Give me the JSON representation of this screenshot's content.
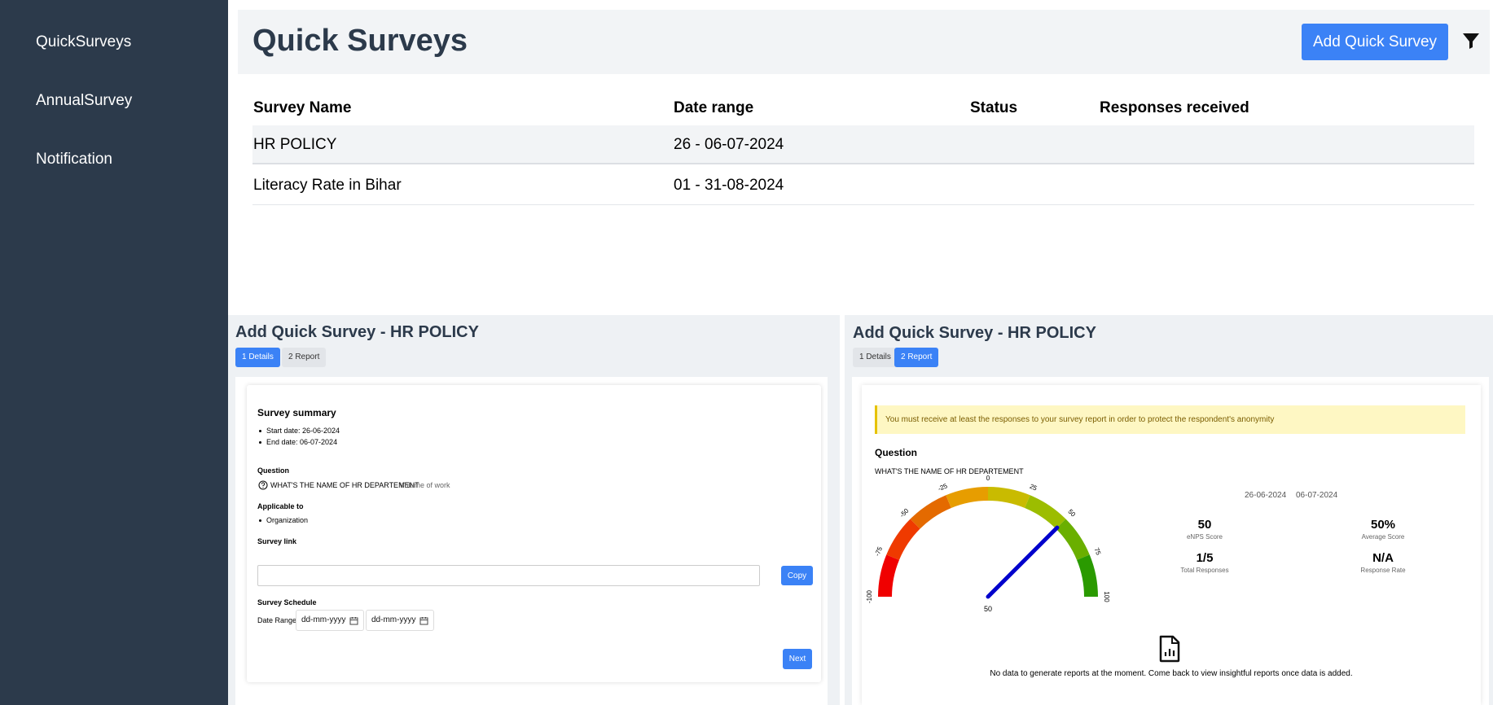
{
  "sidebar": {
    "items": [
      {
        "label": "QuickSurveys"
      },
      {
        "label": "AnnualSurvey"
      },
      {
        "label": "Notification"
      }
    ]
  },
  "header": {
    "title": "Quick Surveys",
    "add_button": "Add Quick Survey",
    "filter_icon": "filter-icon"
  },
  "table": {
    "columns": [
      "Survey Name",
      "Date range",
      "Status",
      "Responses received"
    ],
    "rows": [
      {
        "name": "HR POLICY",
        "date_range": "26 - 06-07-2024",
        "status": "",
        "responses": ""
      },
      {
        "name": "Literacy Rate in Bihar",
        "date_range": "01 - 31-08-2024",
        "status": "",
        "responses": ""
      }
    ]
  },
  "details_panel": {
    "title": "Add Quick Survey - HR POLICY",
    "steps": [
      "1 Details",
      "2 Report"
    ],
    "summary_title": "Survey summary",
    "start_date": "Start date: 26-06-2024",
    "end_date": "End date: 06-07-2024",
    "question_label": "Question",
    "question_text": "WHAT'S THE NAME OF HR DEPARTEMENT",
    "question_tag": "Volume of work",
    "applicable_label": "Applicable to",
    "applicable_value": "Organization",
    "survey_link_label": "Survey link",
    "survey_link_value": "",
    "copy_button": "Copy",
    "schedule_label": "Survey Schedule",
    "date_range_label": "Date Range:",
    "date_from_placeholder": "dd-mm-yyyy",
    "date_to_placeholder": "dd-mm-yyyy",
    "next_button": "Next"
  },
  "report_panel": {
    "title": "Add Quick Survey - HR POLICY",
    "steps": [
      "1 Details",
      "2 Report"
    ],
    "warning": "You must receive at least the responses to your survey report in order to protect the respondent's anonymity",
    "question_label": "Question",
    "question_text": "WHAT'S THE NAME OF HR DEPARTEMENT",
    "gauge": {
      "ticks": [
        "-100",
        "-75",
        "-50",
        "-25",
        "0",
        "25",
        "50",
        "75",
        "100"
      ],
      "value": 50,
      "value_label": "50"
    },
    "date_from": "26-06-2024",
    "date_to": "06-07-2024",
    "stats": [
      {
        "value": "50",
        "label": "eNPS Score"
      },
      {
        "value": "50%",
        "label": "Average Score"
      },
      {
        "value": "1/5",
        "label": "Total Responses"
      },
      {
        "value": "N/A",
        "label": "Response Rate"
      }
    ],
    "empty_message": "No data to generate reports at the moment. Come back to view insightful reports once data is added.",
    "colors": {
      "accent": "#3b82f6",
      "needle": "#0000cc"
    }
  }
}
